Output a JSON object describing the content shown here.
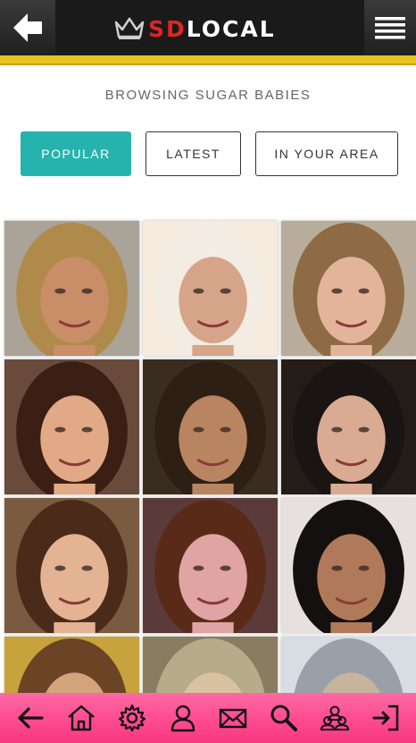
{
  "header": {
    "logo_primary": "SD",
    "logo_secondary": "LOCAL"
  },
  "page": {
    "heading": "BROWSING SUGAR BABIES"
  },
  "filters": [
    {
      "label": "POPULAR",
      "active": true
    },
    {
      "label": "LATEST",
      "active": false
    },
    {
      "label": "IN YOUR AREA",
      "active": false
    }
  ],
  "profiles": [
    {
      "hair": "#b08a4a",
      "skin": "#c98d68",
      "bg": "#a9a398"
    },
    {
      "hair": "#f2ece2",
      "skin": "#d6a489",
      "bg": "#f6ebdd"
    },
    {
      "hair": "#8e6b44",
      "skin": "#e4b49a",
      "bg": "#b8ad9b"
    },
    {
      "hair": "#3b1e14",
      "skin": "#e1a985",
      "bg": "#6a4a3a"
    },
    {
      "hair": "#2e1f15",
      "skin": "#b98460",
      "bg": "#3a2d20"
    },
    {
      "hair": "#1a1412",
      "skin": "#d9ab93",
      "bg": "#241c18"
    },
    {
      "hair": "#4a2b1a",
      "skin": "#e3b393",
      "bg": "#7a5b40"
    },
    {
      "hair": "#5a2a18",
      "skin": "#e1a4a4",
      "bg": "#5b3a3a"
    },
    {
      "hair": "#141010",
      "skin": "#b07a5a",
      "bg": "#e6e0de"
    },
    {
      "hair": "#6b4425",
      "skin": "#d3a37c",
      "bg": "#c8a23c"
    },
    {
      "hair": "#b8ab8a",
      "skin": "#d9c2a0",
      "bg": "#8a7c60"
    },
    {
      "hair": "#9aa0a8",
      "skin": "#c7b49c",
      "bg": "#d8dde3"
    }
  ],
  "colors": {
    "accent": "#26b3ad",
    "brand_red": "#e02424",
    "header_bg": "#1a1a1a",
    "yellow_bar": "#e8c21e",
    "bottom_bar": "#ff4d92"
  },
  "bottom_nav": [
    {
      "icon": "arrow-left-icon"
    },
    {
      "icon": "home-icon"
    },
    {
      "icon": "gear-icon"
    },
    {
      "icon": "user-icon"
    },
    {
      "icon": "envelope-icon"
    },
    {
      "icon": "search-icon"
    },
    {
      "icon": "people-icon"
    },
    {
      "icon": "logout-icon"
    }
  ]
}
